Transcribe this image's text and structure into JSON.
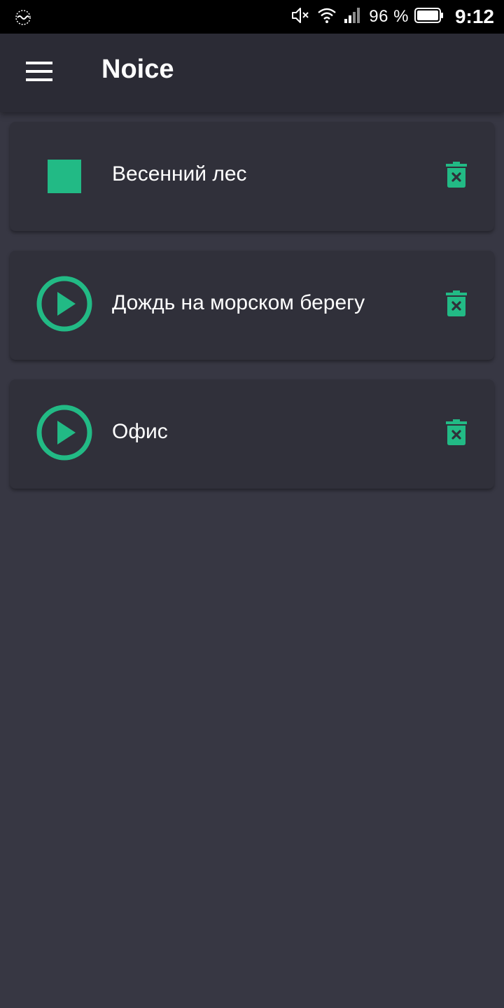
{
  "status_bar": {
    "battery_percent": "96 %",
    "time": "9:12",
    "icons": [
      "app-notification-icon",
      "mute-icon",
      "wifi-icon",
      "signal-icon",
      "battery-icon"
    ]
  },
  "app_bar": {
    "title": "Noice",
    "menu_icon": "hamburger-menu-icon"
  },
  "presets": [
    {
      "name": "Весенний лес",
      "state": "playing",
      "control_icon": "stop-icon",
      "delete_icon": "delete-icon"
    },
    {
      "name": "Дождь на морском берегу",
      "state": "stopped",
      "control_icon": "play-icon",
      "delete_icon": "delete-icon"
    },
    {
      "name": "Офис",
      "state": "stopped",
      "control_icon": "play-icon",
      "delete_icon": "delete-icon"
    }
  ],
  "colors": {
    "accent": "#22ba85",
    "background": "#373743",
    "app_bar": "#2b2b35",
    "card": "#30303a",
    "status_bar": "#000000"
  }
}
